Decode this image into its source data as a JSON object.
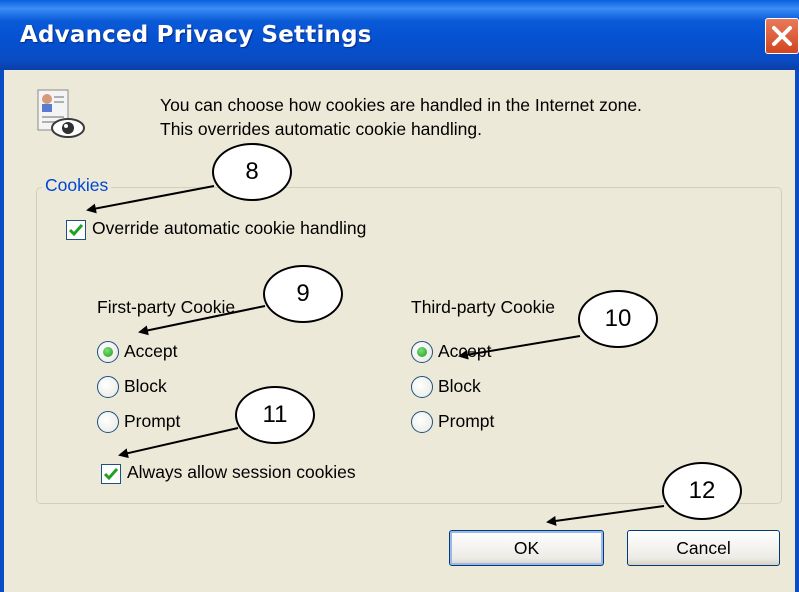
{
  "window": {
    "title": "Advanced Privacy Settings"
  },
  "description": {
    "line1": "You can choose how cookies are handled in the Internet zone.",
    "line2": "This overrides automatic cookie handling."
  },
  "cookies_group": {
    "legend": "Cookies",
    "override_label": "Override automatic cookie handling",
    "override_checked": true,
    "first_party": {
      "heading": "First-party Cookie",
      "options": [
        "Accept",
        "Block",
        "Prompt"
      ],
      "selected": "Accept"
    },
    "third_party": {
      "heading": "Third-party Cookie",
      "options": [
        "Accept",
        "Block",
        "Prompt"
      ],
      "selected": "Accept"
    },
    "session_label": "Always allow session cookies",
    "session_checked": true
  },
  "buttons": {
    "ok": "OK",
    "cancel": "Cancel"
  },
  "callouts": [
    "8",
    "9",
    "10",
    "11",
    "12"
  ],
  "colors": {
    "titlebar": "#0a4cc4",
    "legend_text": "#0046d5",
    "radio_selected": "#1e9a1e",
    "close_button": "#d24520"
  },
  "icons": {
    "close": "close-icon",
    "info": "privacy-document-eye-icon",
    "check": "check-icon"
  }
}
